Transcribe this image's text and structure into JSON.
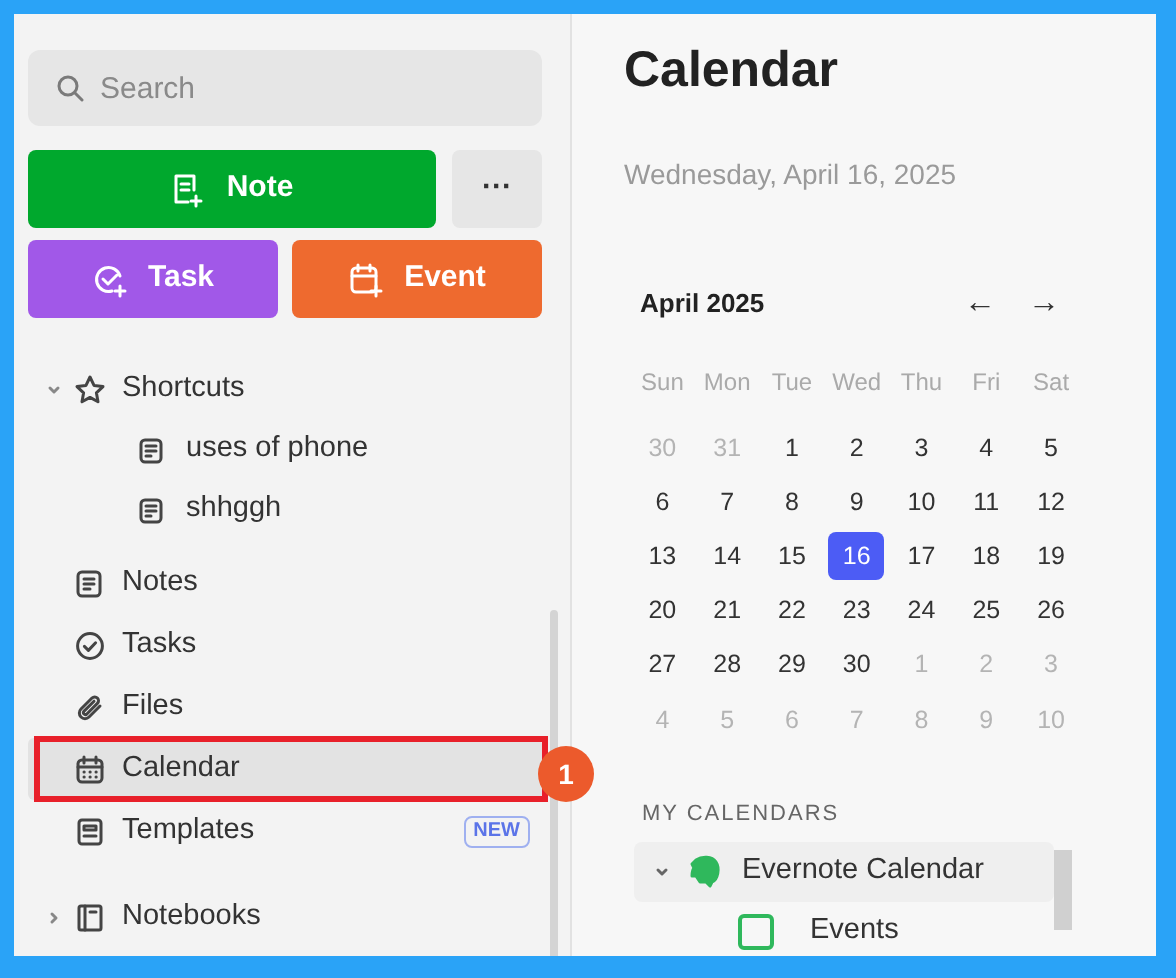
{
  "sidebar": {
    "search": {
      "placeholder": "Search"
    },
    "create_buttons": [
      {
        "label": "Note",
        "kind": "note"
      },
      {
        "label": "Task",
        "kind": "task"
      },
      {
        "label": "Event",
        "kind": "event"
      }
    ],
    "more_button": "···",
    "items": [
      {
        "label": "Shortcuts",
        "kind": "shortcuts",
        "expanded": true,
        "selected": false,
        "children": [
          {
            "label": "uses of phone"
          },
          {
            "label": "shhggh"
          }
        ]
      },
      {
        "label": "Notes",
        "kind": "notes",
        "selected": false
      },
      {
        "label": "Tasks",
        "kind": "tasks",
        "selected": false
      },
      {
        "label": "Files",
        "kind": "files",
        "selected": false
      },
      {
        "label": "Calendar",
        "kind": "calendar",
        "selected": true
      },
      {
        "label": "Templates",
        "kind": "templates",
        "selected": false,
        "badge": "NEW"
      },
      {
        "label": "Notebooks",
        "kind": "notebooks",
        "expanded": false,
        "selected": false
      }
    ]
  },
  "annotation": {
    "number": "1"
  },
  "main": {
    "title": "Calendar",
    "date": "Wednesday, April 16, 2025",
    "month": "April 2025",
    "prev": "←",
    "next": "→",
    "weekdays": [
      "Sun",
      "Mon",
      "Tue",
      "Wed",
      "Thu",
      "Fri",
      "Sat"
    ],
    "weeks": [
      [
        {
          "day": "30",
          "muted": true,
          "selected": false
        },
        {
          "day": "31",
          "muted": true,
          "selected": false
        },
        {
          "day": "1",
          "muted": false,
          "selected": false
        },
        {
          "day": "2",
          "muted": false,
          "selected": false
        },
        {
          "day": "3",
          "muted": false,
          "selected": false
        },
        {
          "day": "4",
          "muted": false,
          "selected": false
        },
        {
          "day": "5",
          "muted": false,
          "selected": false
        }
      ],
      [
        {
          "day": "6",
          "muted": false,
          "selected": false
        },
        {
          "day": "7",
          "muted": false,
          "selected": false
        },
        {
          "day": "8",
          "muted": false,
          "selected": false
        },
        {
          "day": "9",
          "muted": false,
          "selected": false
        },
        {
          "day": "10",
          "muted": false,
          "selected": false
        },
        {
          "day": "11",
          "muted": false,
          "selected": false
        },
        {
          "day": "12",
          "muted": false,
          "selected": false
        }
      ],
      [
        {
          "day": "13",
          "muted": false,
          "selected": false
        },
        {
          "day": "14",
          "muted": false,
          "selected": false
        },
        {
          "day": "15",
          "muted": false,
          "selected": false
        },
        {
          "day": "16",
          "muted": false,
          "selected": true
        },
        {
          "day": "17",
          "muted": false,
          "selected": false
        },
        {
          "day": "18",
          "muted": false,
          "selected": false
        },
        {
          "day": "19",
          "muted": false,
          "selected": false
        }
      ],
      [
        {
          "day": "20",
          "muted": false,
          "selected": false
        },
        {
          "day": "21",
          "muted": false,
          "selected": false
        },
        {
          "day": "22",
          "muted": false,
          "selected": false
        },
        {
          "day": "23",
          "muted": false,
          "selected": false
        },
        {
          "day": "24",
          "muted": false,
          "selected": false
        },
        {
          "day": "25",
          "muted": false,
          "selected": false
        },
        {
          "day": "26",
          "muted": false,
          "selected": false
        }
      ],
      [
        {
          "day": "27",
          "muted": false,
          "selected": false
        },
        {
          "day": "28",
          "muted": false,
          "selected": false
        },
        {
          "day": "29",
          "muted": false,
          "selected": false
        },
        {
          "day": "30",
          "muted": false,
          "selected": false
        },
        {
          "day": "1",
          "muted": true,
          "selected": false
        },
        {
          "day": "2",
          "muted": true,
          "selected": false
        },
        {
          "day": "3",
          "muted": true,
          "selected": false
        }
      ],
      [
        {
          "day": "4",
          "muted": true,
          "selected": false
        },
        {
          "day": "5",
          "muted": true,
          "selected": false
        },
        {
          "day": "6",
          "muted": true,
          "selected": false
        },
        {
          "day": "7",
          "muted": true,
          "selected": false
        },
        {
          "day": "8",
          "muted": true,
          "selected": false
        },
        {
          "day": "9",
          "muted": true,
          "selected": false
        },
        {
          "day": "10",
          "muted": true,
          "selected": false
        }
      ]
    ],
    "my_calendars": {
      "heading": "MY CALENDARS",
      "group": {
        "label": "Evernote Calendar",
        "expanded": true
      },
      "calendars": [
        {
          "label": "Events",
          "checked": false,
          "color": "#2fb85c"
        }
      ]
    }
  }
}
